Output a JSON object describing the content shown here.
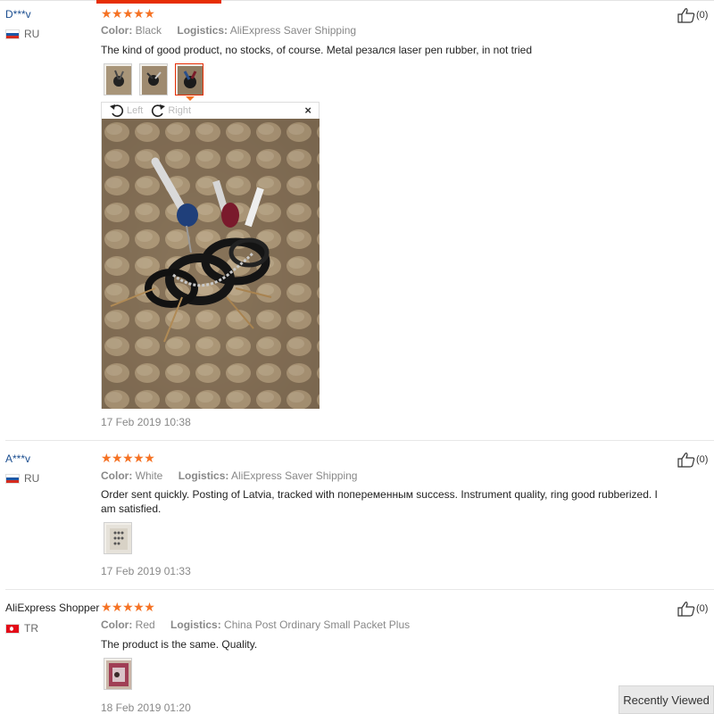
{
  "colors": {
    "accent": "#e62e04",
    "star": "#f57224",
    "link": "#1a4d8f",
    "muted": "#888888"
  },
  "icons": {
    "like": "thumbs-up-icon",
    "rotate_left": "rotate-left-icon",
    "rotate_right": "rotate-right-icon",
    "close": "close-icon",
    "star": "star-icon"
  },
  "labels": {
    "color": "Color:",
    "logistics": "Logistics:"
  },
  "viewer": {
    "rotate_left": "Left",
    "rotate_right": "Right",
    "close": "×"
  },
  "reviews": [
    {
      "user": "D***v",
      "country": "RU",
      "rating": 5,
      "stars": "★★★★★",
      "color": "Black",
      "logistics": "AliExpress Saver Shipping",
      "text": "The kind of good product, no stocks, of course. Metal резался laser pen rubber, in not tried",
      "date": "17 Feb 2019 10:38",
      "likes": "(0)"
    },
    {
      "user": "A***v",
      "country": "RU",
      "rating": 5,
      "stars": "★★★★★",
      "color": "White",
      "logistics": "AliExpress Saver Shipping",
      "text": "Order sent quickly. Posting of Latvia, tracked with попеременным success. Instrument quality, ring good rubberized. I am satisfied.",
      "date": "17 Feb 2019 01:33",
      "likes": "(0)"
    },
    {
      "user": "AliExpress Shopper",
      "country": "TR",
      "rating": 5,
      "stars": "★★★★★",
      "color": "Red",
      "logistics": "China Post Ordinary Small Packet Plus",
      "text": "The product is the same. Quality.",
      "date": "18 Feb 2019 01:20",
      "likes": "(0)"
    }
  ],
  "footer": {
    "recently_viewed": "Recently Viewed"
  }
}
